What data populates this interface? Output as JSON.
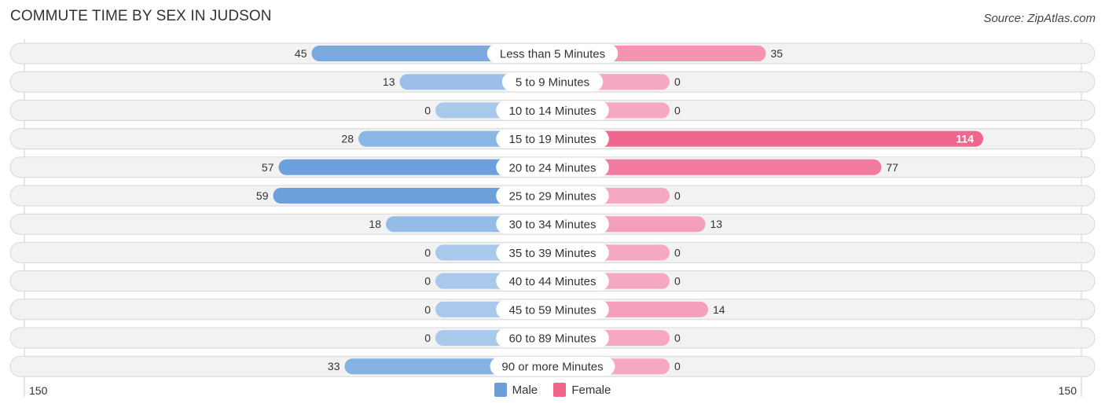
{
  "header": {
    "title": "COMMUTE TIME BY SEX IN JUDSON",
    "source": "Source: ZipAtlas.com"
  },
  "colors": {
    "male": "#6a9fdc",
    "male_light": "#a8c8ec",
    "female": "#f0668f",
    "female_light": "#f6a8c0",
    "row_bg": "#f2f2f2",
    "row_border": "#d8d8d8"
  },
  "chart_data": {
    "type": "bar",
    "orientation": "horizontal-diverging",
    "title": "COMMUTE TIME BY SEX IN JUDSON",
    "categories": [
      "Less than 5 Minutes",
      "5 to 9 Minutes",
      "10 to 14 Minutes",
      "15 to 19 Minutes",
      "20 to 24 Minutes",
      "25 to 29 Minutes",
      "30 to 34 Minutes",
      "35 to 39 Minutes",
      "40 to 44 Minutes",
      "45 to 59 Minutes",
      "60 to 89 Minutes",
      "90 or more Minutes"
    ],
    "series": [
      {
        "name": "Male",
        "values": [
          45,
          13,
          0,
          28,
          57,
          59,
          18,
          0,
          0,
          0,
          0,
          33
        ]
      },
      {
        "name": "Female",
        "values": [
          35,
          0,
          0,
          114,
          77,
          0,
          13,
          0,
          0,
          14,
          0,
          0
        ]
      }
    ],
    "axis": {
      "min_label": "150",
      "max_label": "150",
      "range": [
        150,
        150
      ]
    },
    "legend": {
      "position": "bottom-center",
      "entries": [
        "Male",
        "Female"
      ]
    }
  }
}
